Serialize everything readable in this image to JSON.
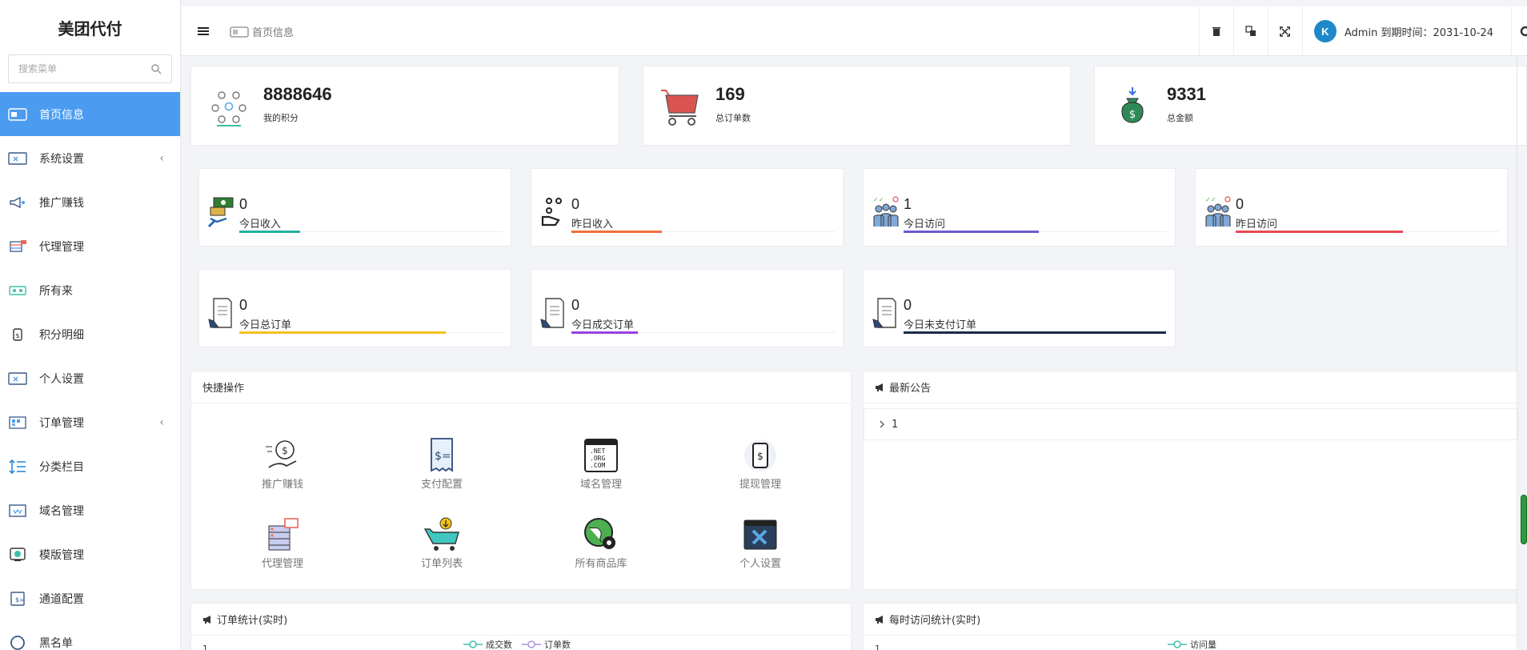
{
  "brand": "美团代付",
  "search": {
    "placeholder": "搜索菜单"
  },
  "menu": [
    {
      "label": "首页信息",
      "icon": "dashboard-icon",
      "active": true,
      "arrow": ""
    },
    {
      "label": "系统设置",
      "icon": "settings-panel-icon",
      "active": false,
      "arrow": "‹"
    },
    {
      "label": "推广赚钱",
      "icon": "megaphone-icon",
      "active": false,
      "arrow": ""
    },
    {
      "label": "代理管理",
      "icon": "agent-rack-icon",
      "active": false,
      "arrow": ""
    },
    {
      "label": "所有来",
      "icon": "goods-library-icon",
      "active": false,
      "arrow": ""
    },
    {
      "label": "积分明细",
      "icon": "points-icon",
      "active": false,
      "arrow": ""
    },
    {
      "label": "个人设置",
      "icon": "profile-settings-icon",
      "active": false,
      "arrow": ""
    },
    {
      "label": "订单管理",
      "icon": "orders-icon",
      "active": false,
      "arrow": "‹"
    },
    {
      "label": "分类栏目",
      "icon": "category-icon",
      "active": false,
      "arrow": ""
    },
    {
      "label": "域名管理",
      "icon": "domain-icon",
      "active": false,
      "arrow": ""
    },
    {
      "label": "模版管理",
      "icon": "template-icon",
      "active": false,
      "arrow": ""
    },
    {
      "label": "通道配置",
      "icon": "channel-icon",
      "active": false,
      "arrow": ""
    },
    {
      "label": "黑名单",
      "icon": "blacklist-icon",
      "active": false,
      "arrow": ""
    }
  ],
  "topbar": {
    "breadcrumb": "首页信息",
    "user_text": "Admin 到期时间：2031-10-24",
    "avatar_letter": "K"
  },
  "big_stats": [
    {
      "value": "8888646",
      "label": "我的积分",
      "icon": "team-icon"
    },
    {
      "value": "169",
      "label": "总订单数",
      "icon": "shopping-cart-icon"
    },
    {
      "value": "9331",
      "label": "总金额",
      "icon": "money-bag-icon"
    }
  ],
  "small_stats": [
    {
      "value": "0",
      "label": "今日收入",
      "icon": "income-hand-icon",
      "bar_color": "#20b2a0",
      "fill": 0.23
    },
    {
      "value": "0",
      "label": "昨日收入",
      "icon": "coins-hand-icon",
      "bar_color": "#f0703a",
      "fill": 0.34
    },
    {
      "value": "1",
      "label": "今日访问",
      "icon": "visitors-icon",
      "bar_color": "#6a5acd",
      "fill": 0.51
    },
    {
      "value": "0",
      "label": "昨日访问",
      "icon": "visitors-icon",
      "bar_color": "#e84a50",
      "fill": 0.63
    },
    {
      "value": "0",
      "label": "今日总订单",
      "icon": "order-doc-icon",
      "bar_color": "#f5c11a",
      "fill": 0.78
    },
    {
      "value": "0",
      "label": "今日成交订单",
      "icon": "order-doc-icon",
      "bar_color": "#9b3fe0",
      "fill": 0.25
    },
    {
      "value": "0",
      "label": "今日未支付订单",
      "icon": "order-doc-icon",
      "bar_color": "#1b2a4a",
      "fill": 0.99
    }
  ],
  "quick": {
    "title": "快捷操作",
    "items": [
      {
        "label": "推广赚钱",
        "icon": "money-hand-icon"
      },
      {
        "label": "支付配置",
        "icon": "receipt-icon"
      },
      {
        "label": "域名管理",
        "icon": "domain-list-icon"
      },
      {
        "label": "提现管理",
        "icon": "phone-dollar-icon"
      },
      {
        "label": "代理管理",
        "icon": "server-rack-icon"
      },
      {
        "label": "订单列表",
        "icon": "cart-download-icon"
      },
      {
        "label": "所有商品库",
        "icon": "globe-gear-icon"
      },
      {
        "label": "个人设置",
        "icon": "window-tools-icon"
      }
    ]
  },
  "notice": {
    "title": "最新公告",
    "rows": [
      "1"
    ]
  },
  "order_stats": {
    "title": "订单统计(实时)",
    "legend": [
      "成交数",
      "订单数"
    ],
    "axis_top": "1"
  },
  "visit_stats": {
    "title": "每时访问统计(实时)",
    "legend": [
      "访问量"
    ],
    "axis_top": "1"
  },
  "colors": {
    "accent": "#4b9cf1",
    "series_a": "#3fbfad",
    "series_b": "#a994e0"
  }
}
